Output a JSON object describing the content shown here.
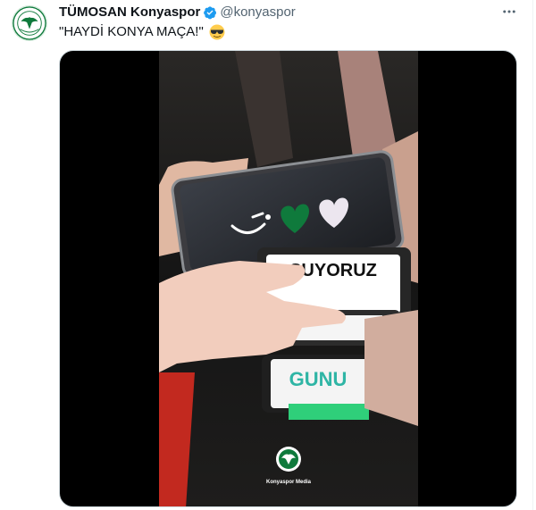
{
  "tweet": {
    "display_name": "TÜMOSAN Konyaspor",
    "handle": "@konyaspor",
    "text": "\"HAYDİ KONYA MAÇA!\"",
    "emoji": "smiling-face-with-sunglasses",
    "verified": true,
    "more_icon": "more-horizontal-icon"
  },
  "media": {
    "phone_texts": {
      "coşuyoruz": "ŞUYORUZ",
      "günü": "GUNU"
    },
    "watermark": "Konyaspor Media"
  },
  "colors": {
    "verified_blue": "#1d9bf0",
    "handle_gray": "#536471",
    "club_green": "#0f7a3c",
    "screen_white": "#ffffff"
  }
}
